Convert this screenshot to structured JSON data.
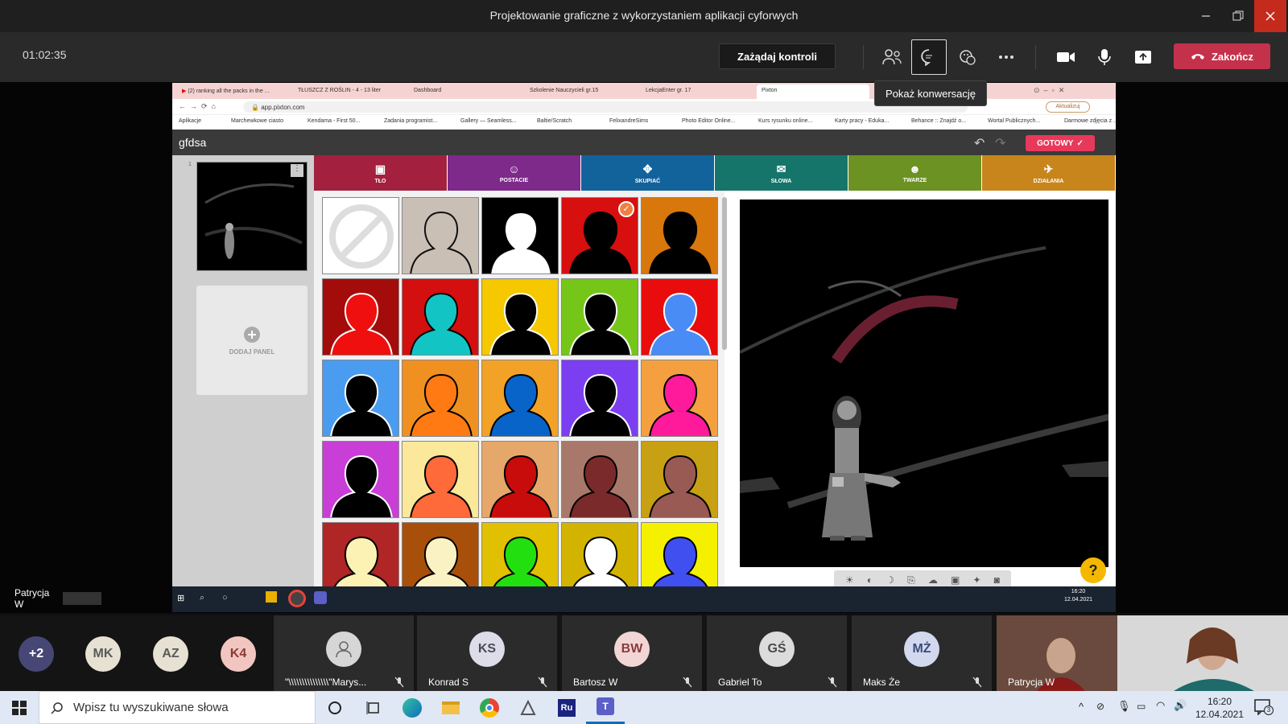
{
  "window": {
    "title": "Projektowanie graficzne z wykorzystaniem aplikacji cyforwych"
  },
  "meeting": {
    "timer": "01:02:35",
    "request_control": "Zażądaj kontroli",
    "leave": "Zakończ",
    "tooltip": "Pokaż konwersację"
  },
  "browser": {
    "tabs": [
      "(2) ranking all the packs in the ...",
      "TŁUSZCZ Z ROŚLIN - 4 - 13 liter",
      "Dashboard",
      "Szkolenie Nauczycieli gr.15",
      "LekcjaEnter gr. 17",
      "Pixton"
    ],
    "url": "app.pixton.com",
    "update_label": "Aktualizuj",
    "bookmarks": [
      "Aplikacje",
      "Marchewkowe ciasto",
      "Kendama - First 50...",
      "Zadania programist...",
      "Gallery — Seamless...",
      "Baltie/Scratch",
      "FelixandreSims",
      "Photo Editor Online...",
      "Kurs rysunku online...",
      "Karty pracy - Eduka...",
      "Behance :: Znajdź o...",
      "Wortal Publicznych...",
      "Darmowe zdjęcia z ..."
    ]
  },
  "pixton": {
    "comic_title": "gfdsa",
    "done": "GOTOWY",
    "panel_number": "1",
    "add_panel": "DODAJ PANEL",
    "help": "?",
    "categories": [
      {
        "label": "TŁO",
        "color": "#a3203f",
        "icon": "image-icon"
      },
      {
        "label": "POSTACIE",
        "color": "#7d2a8a",
        "icon": "character-icon"
      },
      {
        "label": "SKUPIAĆ",
        "color": "#12629c",
        "icon": "move-icon"
      },
      {
        "label": "SŁOWA",
        "color": "#16756b",
        "icon": "speech-icon"
      },
      {
        "label": "TWARZE",
        "color": "#6b9222",
        "icon": "smile-icon"
      },
      {
        "label": "DZIAŁANIA",
        "color": "#c7851c",
        "icon": "action-icon"
      }
    ],
    "swatches": [
      {
        "bg": "#ffffff",
        "fg": "none",
        "outline": "#dddddd",
        "selected": false
      },
      {
        "bg": "#c9bfb5",
        "fg": "#c9bfb5",
        "outline": "#111111",
        "selected": false
      },
      {
        "bg": "#000000",
        "fg": "#ffffff",
        "outline": "#000000",
        "selected": false
      },
      {
        "bg": "#d80f0f",
        "fg": "#000000",
        "outline": "#000000",
        "selected": true
      },
      {
        "bg": "#d8770b",
        "fg": "#000000",
        "outline": "#000000",
        "selected": false
      },
      {
        "bg": "#a40c0c",
        "fg": "#f00f0f",
        "outline": "#ffffff",
        "selected": false
      },
      {
        "bg": "#d40f0f",
        "fg": "#13c4c4",
        "outline": "#000000",
        "selected": false
      },
      {
        "bg": "#f5c800",
        "fg": "#000000",
        "outline": "#ffffff",
        "selected": false
      },
      {
        "bg": "#76c61a",
        "fg": "#000000",
        "outline": "#ffffff",
        "selected": false
      },
      {
        "bg": "#e80c0c",
        "fg": "#4a8cf5",
        "outline": "#ffffff",
        "selected": false
      },
      {
        "bg": "#4a9cf0",
        "fg": "#000000",
        "outline": "#ffffff",
        "selected": false
      },
      {
        "bg": "#f09020",
        "fg": "#ff7a12",
        "outline": "#000000",
        "selected": false
      },
      {
        "bg": "#f2a226",
        "fg": "#0864c8",
        "outline": "#000000",
        "selected": false
      },
      {
        "bg": "#7b3ef0",
        "fg": "#000000",
        "outline": "#ffffff",
        "selected": false
      },
      {
        "bg": "#f4a040",
        "fg": "#ff1a9c",
        "outline": "#000000",
        "selected": false
      },
      {
        "bg": "#c93ed6",
        "fg": "#000000",
        "outline": "#ffffff",
        "selected": false
      },
      {
        "bg": "#fbe89a",
        "fg": "#ff6a3a",
        "outline": "#000000",
        "selected": false
      },
      {
        "bg": "#e6a86a",
        "fg": "#c80c0c",
        "outline": "#000000",
        "selected": false
      },
      {
        "bg": "#a8786a",
        "fg": "#7a2a2a",
        "outline": "#000000",
        "selected": false
      },
      {
        "bg": "#c8a014",
        "fg": "#9a5a54",
        "outline": "#000000",
        "selected": false
      },
      {
        "bg": "#b02525",
        "fg": "#fbf2b4",
        "outline": "#000000",
        "selected": false
      },
      {
        "bg": "#a8500a",
        "fg": "#fbf2c4",
        "outline": "#000000",
        "selected": false
      },
      {
        "bg": "#e0c000",
        "fg": "#22e010",
        "outline": "#000000",
        "selected": false
      },
      {
        "bg": "#d2b400",
        "fg": "#ffffff",
        "outline": "#000000",
        "selected": false
      },
      {
        "bg": "#f5f000",
        "fg": "#4050f0",
        "outline": "#000000",
        "selected": false
      }
    ]
  },
  "inner_taskbar": {
    "time": "16:20",
    "date": "12.04.2021"
  },
  "presenter": {
    "name": "Patrycja W"
  },
  "participants": {
    "overflow": "+2",
    "circles": [
      {
        "initials": "MK",
        "color": "#e6e1d2",
        "text_color": "#5a5a5a"
      },
      {
        "initials": "AZ",
        "color": "#e6e1d2",
        "text_color": "#5a5a5a"
      },
      {
        "initials": "K4",
        "color": "#f2c6c0",
        "text_color": "#8a3a36"
      }
    ],
    "tiles": [
      {
        "initials": "",
        "name": "\"\\\\\\\\\\\\\\\\\\\\\\\\\\\\\\\"Marys...",
        "color": "#d6d6d6",
        "text_color": "#5a5a5a"
      },
      {
        "initials": "KS",
        "name": "Konrad S",
        "color": "#dcdde8",
        "text_color": "#4a4a5a"
      },
      {
        "initials": "BW",
        "name": "Bartosz W",
        "color": "#f2d6d6",
        "text_color": "#8a3a3a"
      },
      {
        "initials": "GŚ",
        "name": "Gabriel To",
        "color": "#dcdcdc",
        "text_color": "#4a4a4a"
      },
      {
        "initials": "MŻ",
        "name": "Maks Że",
        "color": "#d2d8ee",
        "text_color": "#3a4a7a"
      }
    ],
    "video_name": "Patrycja W"
  },
  "taskbar": {
    "search_placeholder": "Wpisz tu wyszukiwane słowa",
    "time": "16:20",
    "date": "12.04.2021",
    "notifications": "3"
  }
}
